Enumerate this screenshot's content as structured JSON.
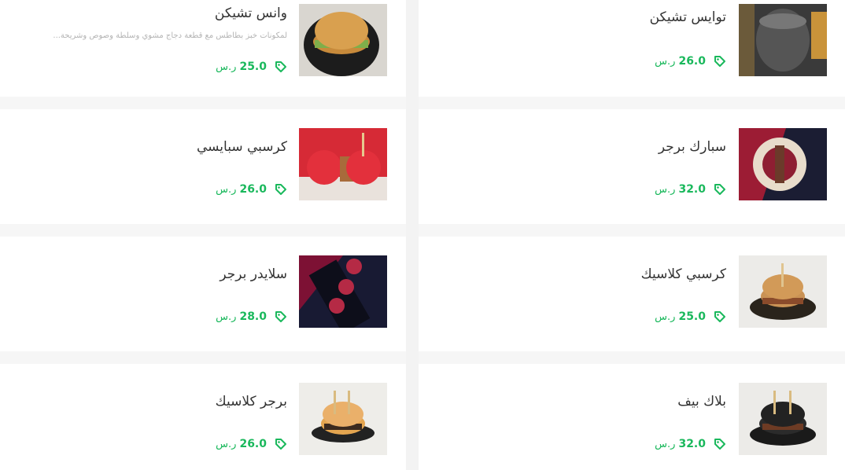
{
  "currency_label": "ر.س",
  "colors": {
    "accent": "#1ab85c",
    "text": "#333333",
    "muted": "#b4b4b4"
  },
  "items": [
    {
      "name": "وانس تشيكن",
      "description": "لمكونات خبز بطاطس مع قطعة دجاج مشوي وسلطة وصوص وشريحة...",
      "price": "25.0",
      "image": "burger-plate"
    },
    {
      "name": "توايس تشيكن",
      "description": "",
      "price": "26.0",
      "image": "dark-cup"
    },
    {
      "name": "كرسبي سبايسي",
      "description": "",
      "price": "26.0",
      "image": "red-burger"
    },
    {
      "name": "سبارك برجر",
      "description": "",
      "price": "32.0",
      "image": "red-bun-split"
    },
    {
      "name": "سلايدر برجر",
      "description": "",
      "price": "28.0",
      "image": "red-sliders"
    },
    {
      "name": "كرسبي كلاسيك",
      "description": "",
      "price": "25.0",
      "image": "dark-bun-plate"
    },
    {
      "name": "برجر كلاسيك",
      "description": "",
      "price": "26.0",
      "image": "classic-burger"
    },
    {
      "name": "بلاك بيف",
      "description": "",
      "price": "32.0",
      "image": "black-burger"
    }
  ]
}
